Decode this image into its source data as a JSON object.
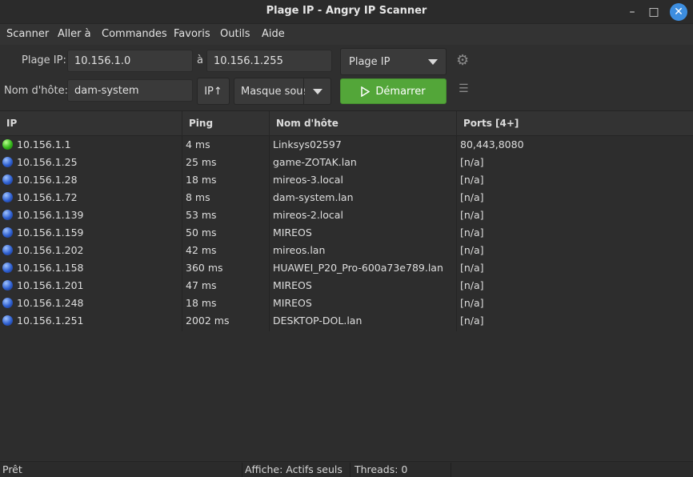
{
  "window": {
    "title": "Plage IP - Angry IP Scanner",
    "controls": {
      "minimize": "–",
      "maximize": "□",
      "close": "✕"
    }
  },
  "menu": [
    "Scanner",
    "Aller à",
    "Commandes",
    "Favoris",
    "Outils",
    "Aide"
  ],
  "toolbar": {
    "range_label": "Plage IP:",
    "start_ip": "10.156.1.0",
    "to_label": "à",
    "end_ip": "10.156.1.255",
    "mode_select": "Plage IP",
    "host_label": "Nom d'hôte:",
    "hostname": "dam-system",
    "ip_button": "IP↑",
    "mask_select": "Masque sous",
    "start_button": "Démarrer"
  },
  "icons": {
    "gear": "gear-icon",
    "list": "list-icon",
    "play": "play-icon",
    "dropdown": "chevron-down-icon"
  },
  "table": {
    "headers": [
      "IP",
      "Ping",
      "Nom d'hôte",
      "Ports [4+]"
    ],
    "rows": [
      {
        "status": "green",
        "ip": "10.156.1.1",
        "ping": "4 ms",
        "host": "Linksys02597",
        "ports": "80,443,8080"
      },
      {
        "status": "blue",
        "ip": "10.156.1.25",
        "ping": "25 ms",
        "host": "game-ZOTAK.lan",
        "ports": "[n/a]"
      },
      {
        "status": "blue",
        "ip": "10.156.1.28",
        "ping": "18 ms",
        "host": "mireos-3.local",
        "ports": "[n/a]"
      },
      {
        "status": "blue",
        "ip": "10.156.1.72",
        "ping": "8 ms",
        "host": "dam-system.lan",
        "ports": "[n/a]"
      },
      {
        "status": "blue",
        "ip": "10.156.1.139",
        "ping": "53 ms",
        "host": "mireos-2.local",
        "ports": "[n/a]"
      },
      {
        "status": "blue",
        "ip": "10.156.1.159",
        "ping": "50 ms",
        "host": "MIREOS",
        "ports": "[n/a]"
      },
      {
        "status": "blue",
        "ip": "10.156.1.202",
        "ping": "42 ms",
        "host": "mireos.lan",
        "ports": "[n/a]"
      },
      {
        "status": "blue",
        "ip": "10.156.1.158",
        "ping": "360 ms",
        "host": "HUAWEI_P20_Pro-600a73e789.lan",
        "ports": "[n/a]"
      },
      {
        "status": "blue",
        "ip": "10.156.1.201",
        "ping": "47 ms",
        "host": "MIREOS",
        "ports": "[n/a]"
      },
      {
        "status": "blue",
        "ip": "10.156.1.248",
        "ping": "18 ms",
        "host": "MIREOS",
        "ports": "[n/a]"
      },
      {
        "status": "blue",
        "ip": "10.156.1.251",
        "ping": "2002 ms",
        "host": "DESKTOP-DOL.lan",
        "ports": "[n/a]"
      }
    ]
  },
  "statusbar": {
    "state": "Prêt",
    "display": "Affiche: Actifs seuls",
    "threads": "Threads: 0"
  },
  "colors": {
    "start_button": "#53a639",
    "close_button": "#3d8ee0",
    "alive_dot": "#33b51a",
    "dead_dot": "#2e5fd0"
  }
}
